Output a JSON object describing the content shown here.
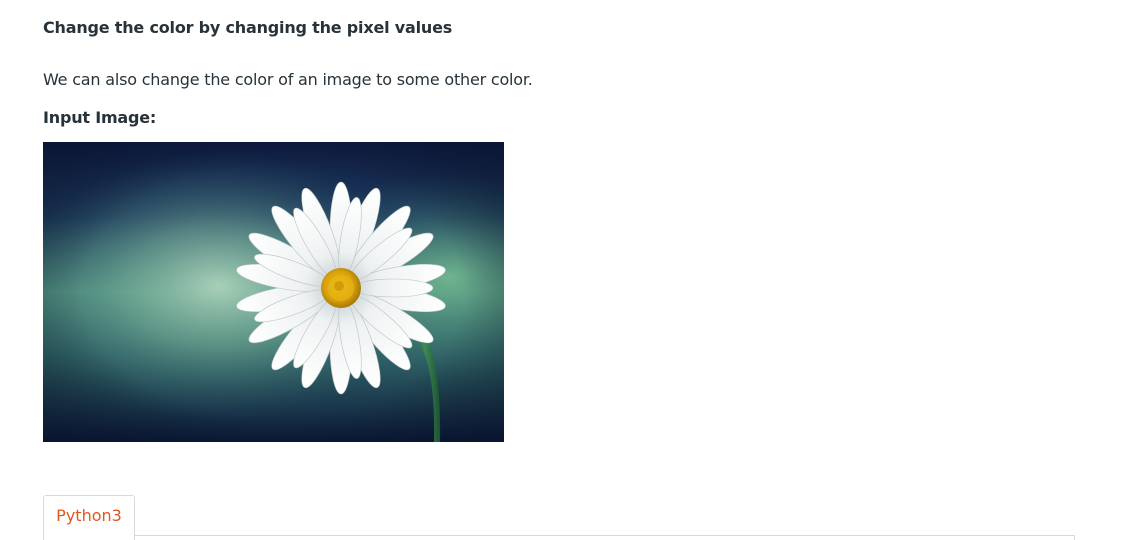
{
  "article": {
    "heading": "Change the color by changing the pixel values",
    "paragraph": "We can also change the color of an image to some other color.",
    "input_label": "Input Image:"
  },
  "code_tabs": {
    "tabs": [
      {
        "label": "Python3",
        "active": true
      }
    ]
  },
  "colors": {
    "text": "#273239",
    "tab_active_text": "#e2561f",
    "tab_border": "#d7dadd"
  },
  "image": {
    "subject": "daisy-flower-photo"
  }
}
